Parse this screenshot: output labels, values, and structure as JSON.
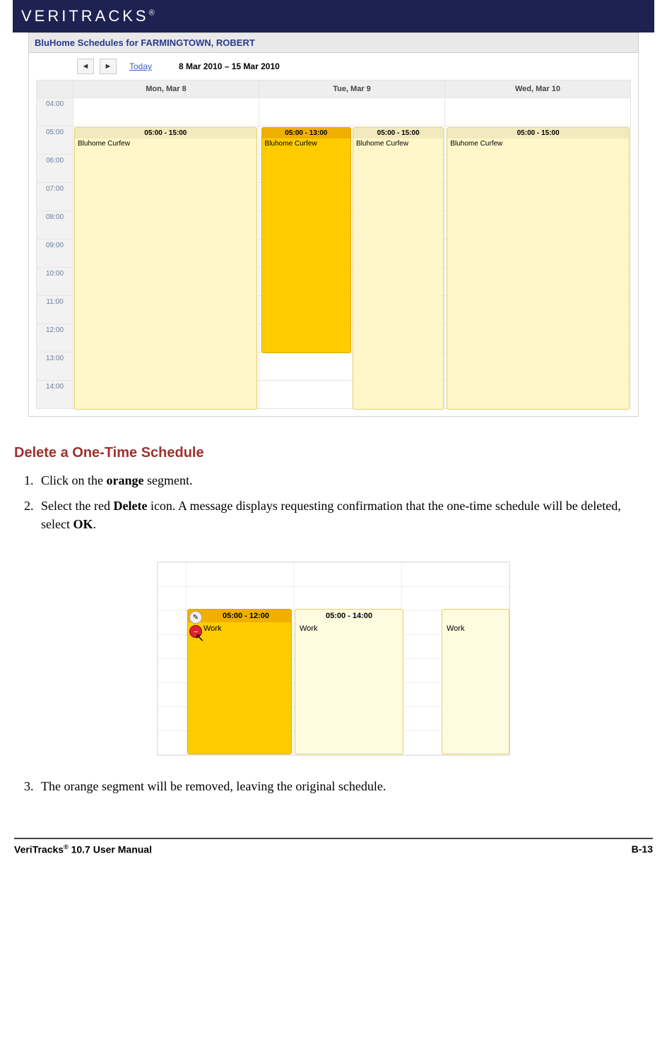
{
  "brand": "VERITRACKS",
  "brand_reg": "®",
  "calendar": {
    "title": "BluHome Schedules for FARMINGTOWN, ROBERT",
    "today_label": "Today",
    "date_range": "8 Mar 2010 – 15 Mar 2010",
    "day_headers": [
      "Mon, Mar 8",
      "Tue, Mar 9",
      "Wed, Mar 10"
    ],
    "time_labels": [
      "04:00",
      "05:00",
      "06:00",
      "07:00",
      "08:00",
      "09:00",
      "10:00",
      "11:00",
      "12:00",
      "13:00",
      "14:00"
    ],
    "events": {
      "mon": {
        "time": "05:00 - 15:00",
        "label": "Bluhome Curfew"
      },
      "tue_orange": {
        "time": "05:00 - 13:00",
        "label": "Bluhome Curfew"
      },
      "tue_under": {
        "time": "05:00 - 15:00",
        "label": "Bluhome Curfew"
      },
      "wed": {
        "time": "05:00 - 15:00",
        "label": "Bluhome Curfew"
      }
    }
  },
  "section": {
    "heading": "Delete a One-Time Schedule",
    "step1_a": "Click on the ",
    "step1_bold": "orange",
    "step1_b": " segment.",
    "step2_a": "Select the red ",
    "step2_bold": "Delete",
    "step2_b": " icon.  A message displays requesting confirmation that the one-time schedule will be deleted, select ",
    "step2_bold2": "OK",
    "step2_c": ".",
    "step3": "The orange segment will be removed, leaving the original schedule."
  },
  "shot2": {
    "orange_time": "05:00 - 12:00",
    "orange_label": "Work",
    "plain_time": "05:00 - 14:00",
    "plain_label": "Work",
    "right_label": "Work"
  },
  "footer": {
    "left_a": "VeriTracks",
    "left_reg": "®",
    "left_b": " 10.7 User Manual",
    "right": "B-13"
  }
}
